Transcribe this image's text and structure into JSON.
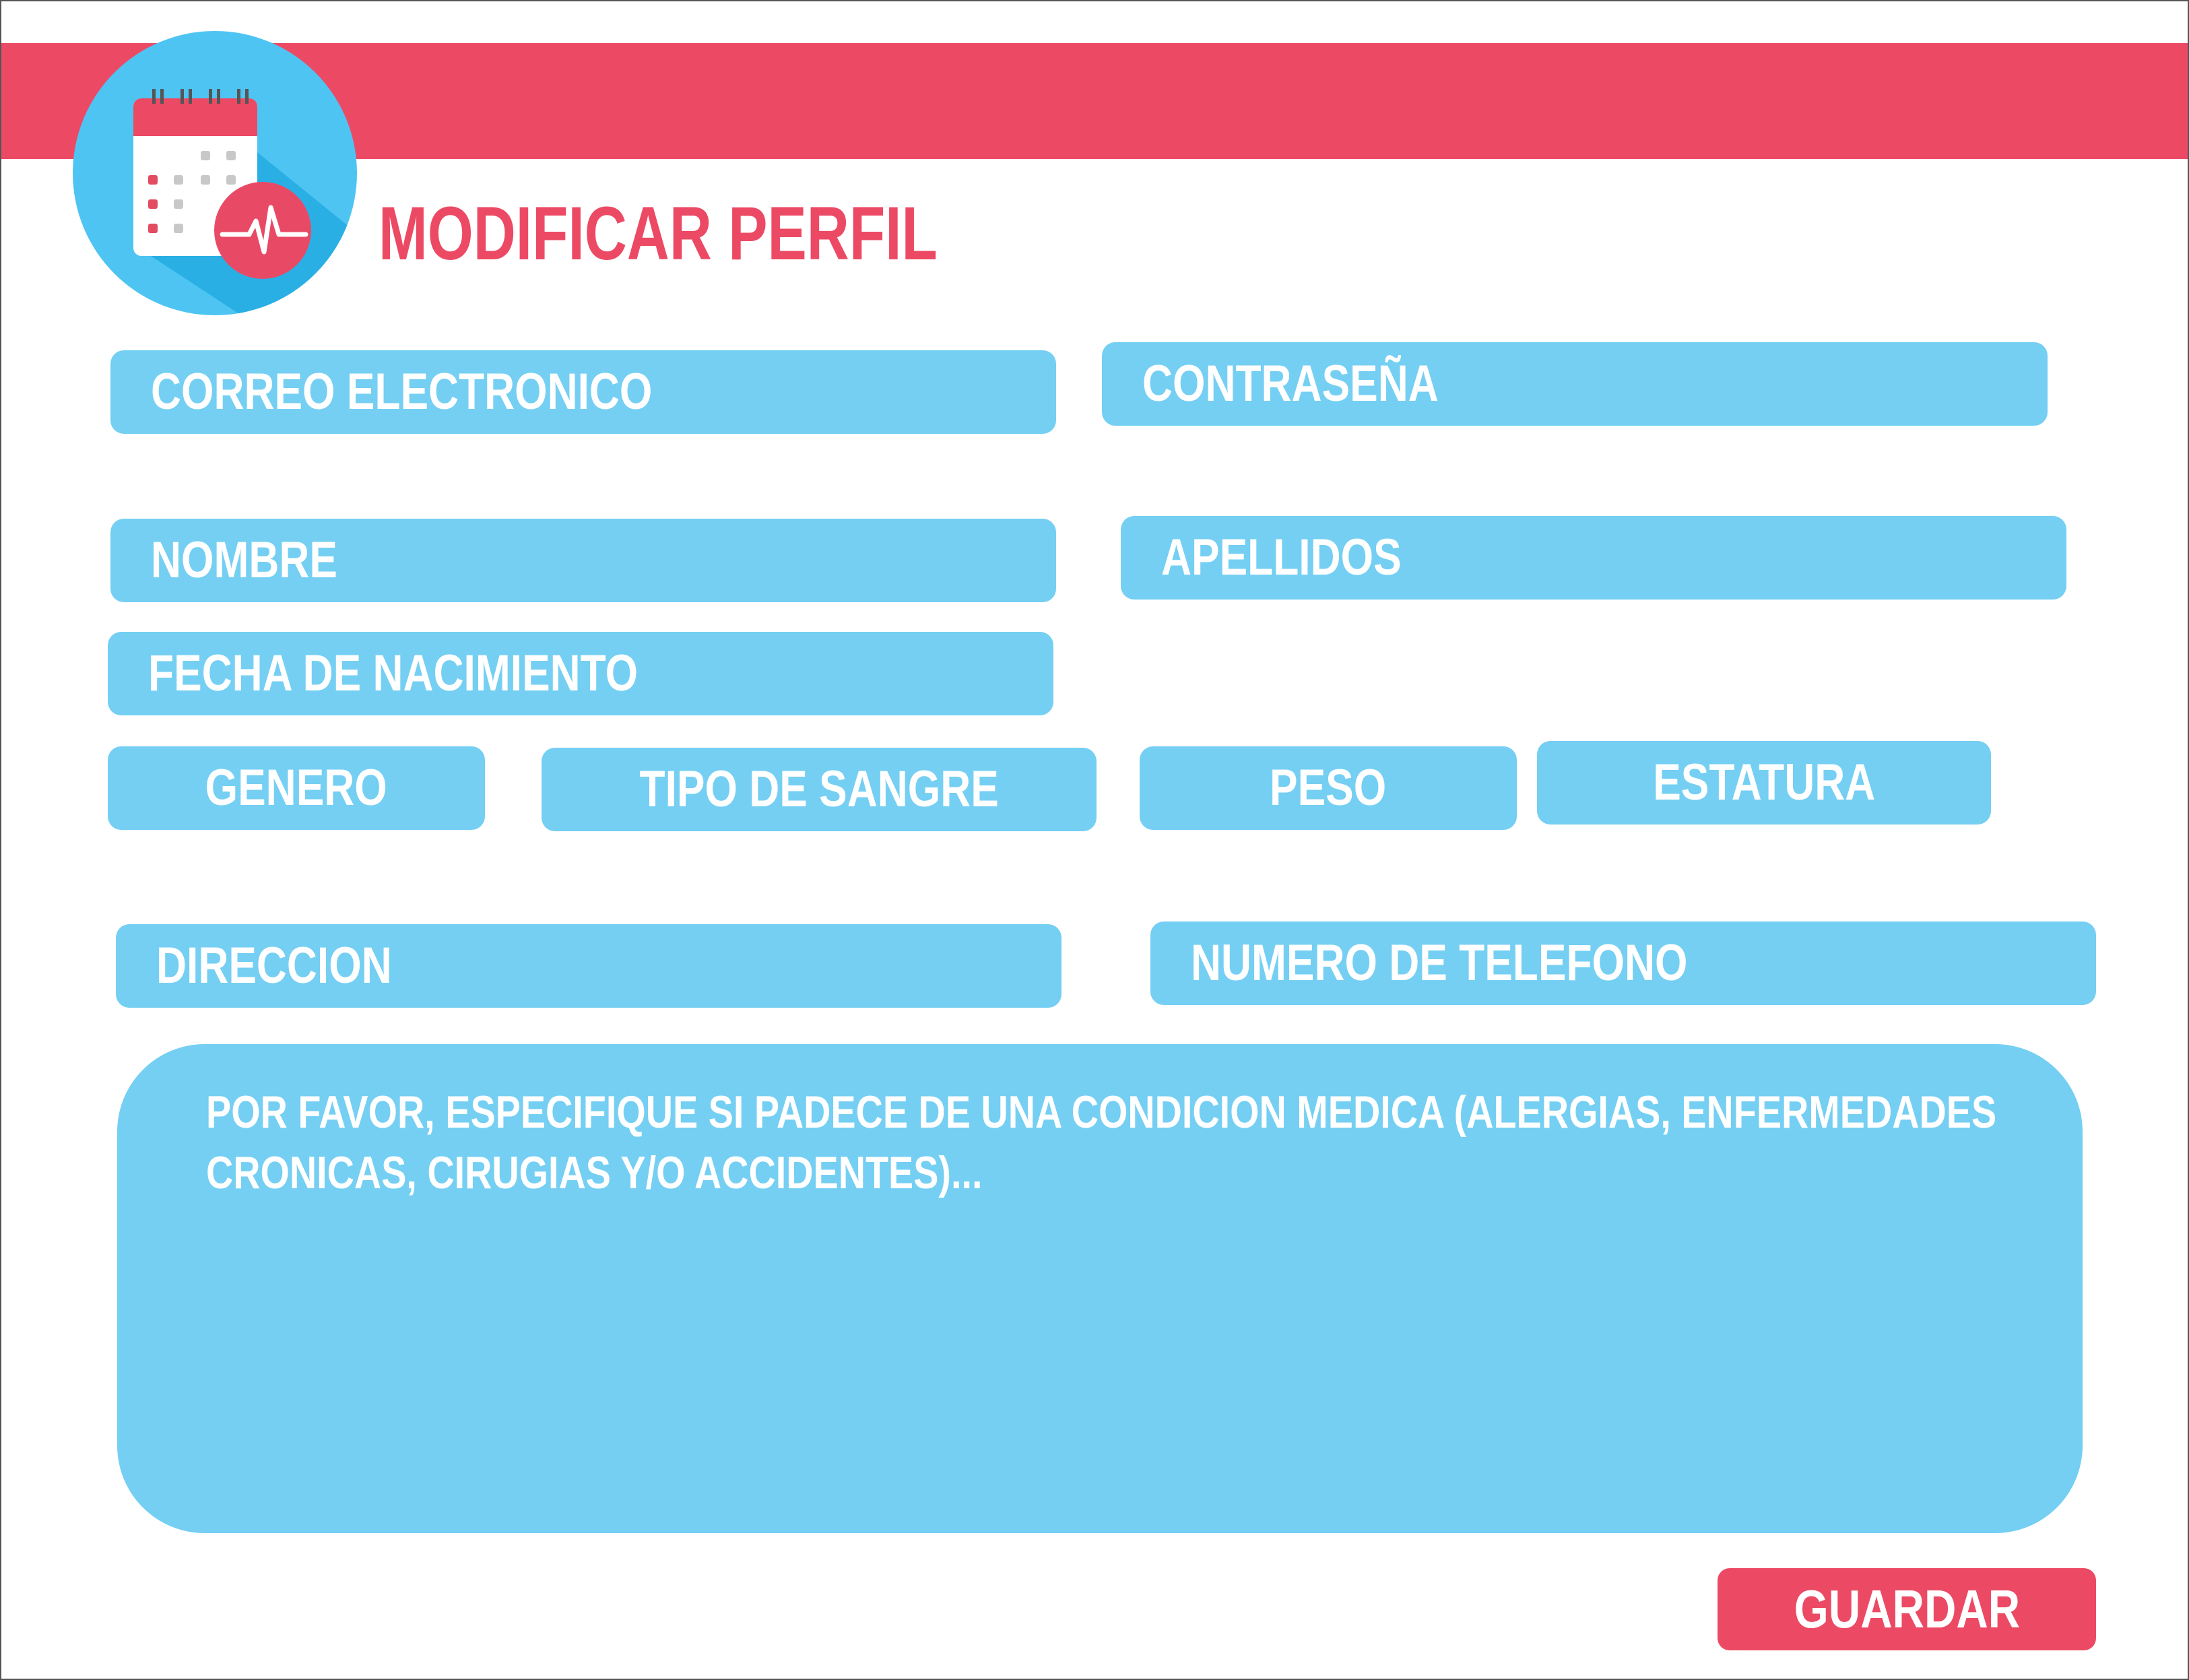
{
  "header": {
    "title": "MODIFICAR PERFIL",
    "logo_icon": "calendar-heartbeat-icon",
    "accent_color": "#ec4a64",
    "field_color": "#74cff3",
    "logo_color": "#4ec4f2"
  },
  "form": {
    "email": "CORREO ELECTRONICO",
    "password": "CONTRASEÑA",
    "first_name": "NOMBRE",
    "last_name": "APELLIDOS",
    "birth_date": "FECHA DE NACIMIENTO",
    "gender": "GENERO",
    "blood_type": "TIPO DE SANGRE",
    "weight": "PESO",
    "height": "ESTATURA",
    "address": "DIRECCION",
    "phone": "NUMERO DE TELEFONO",
    "medical_notes": "POR FAVOR, ESPECIFIQUE SI PADECE DE UNA CONDICION MEDICA (ALERGIAS, ENFERMEDADES CRONICAS, CIRUGIAS Y/O ACCIDENTES)..."
  },
  "actions": {
    "save_label": "GUARDAR"
  }
}
